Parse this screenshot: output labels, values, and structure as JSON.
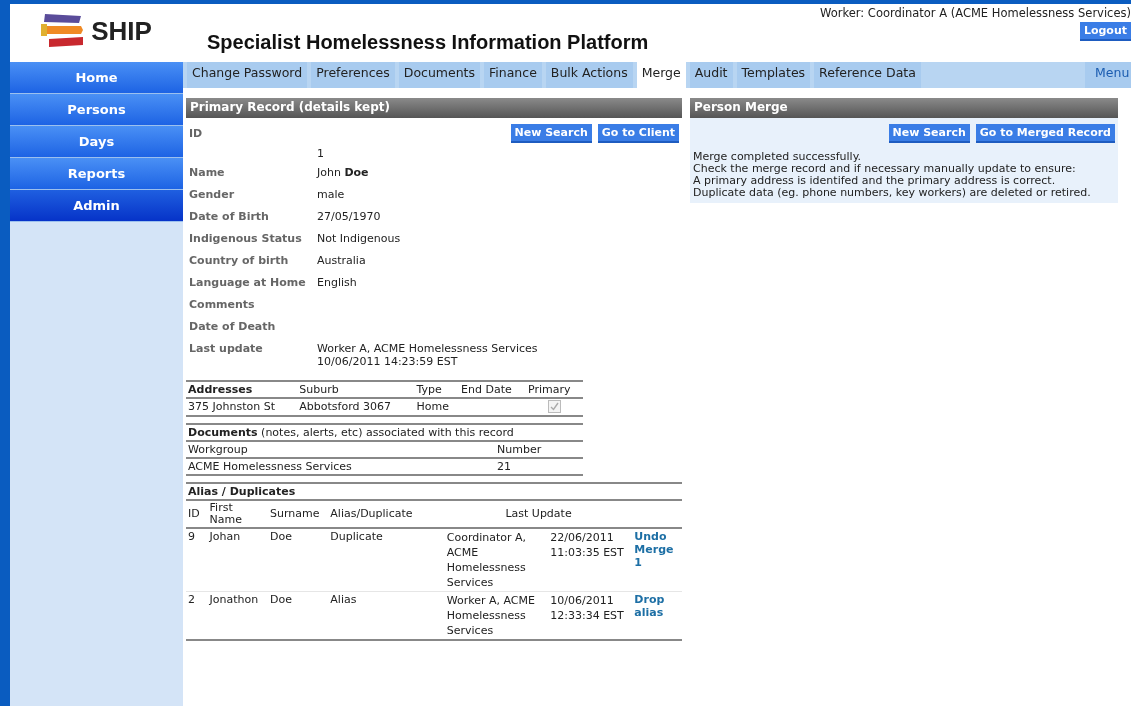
{
  "header": {
    "logo_text": "SHIP",
    "title": "Specialist Homelessness Information Platform",
    "worker": "Worker: Coordinator A (ACME Homelessness Services)",
    "logout": "Logout"
  },
  "sidebar": {
    "items": [
      {
        "label": "Home",
        "selected": false
      },
      {
        "label": "Persons",
        "selected": false
      },
      {
        "label": "Days",
        "selected": false
      },
      {
        "label": "Reports",
        "selected": false
      },
      {
        "label": "Admin",
        "selected": true
      }
    ]
  },
  "tabs": [
    {
      "label": "Change Password",
      "selected": false
    },
    {
      "label": "Preferences",
      "selected": false
    },
    {
      "label": "Documents",
      "selected": false
    },
    {
      "label": "Finance",
      "selected": false
    },
    {
      "label": "Bulk Actions",
      "selected": false
    },
    {
      "label": "Merge",
      "selected": true
    },
    {
      "label": "Audit",
      "selected": false
    },
    {
      "label": "Templates",
      "selected": false
    },
    {
      "label": "Reference Data",
      "selected": false
    }
  ],
  "menu_link": "Menu",
  "primary": {
    "title": "Primary Record (details kept)",
    "buttons": [
      "New Search",
      "Go to Client"
    ],
    "fields": [
      {
        "label": "ID",
        "kind": "stacked",
        "lines": [
          "1"
        ]
      },
      {
        "label": "Name",
        "kind": "inline",
        "lines": [
          "John **Doe**"
        ]
      },
      {
        "label": "Gender",
        "kind": "inline",
        "lines": [
          "male"
        ]
      },
      {
        "label": "Date of Birth",
        "kind": "inline",
        "lines": [
          "27/05/1970"
        ]
      },
      {
        "label": "Indigenous Status",
        "kind": "inline",
        "lines": [
          "Not Indigenous"
        ]
      },
      {
        "label": "Country of birth",
        "kind": "inline",
        "lines": [
          "Australia"
        ]
      },
      {
        "label": "Language at Home",
        "kind": "inline",
        "lines": [
          "English"
        ]
      },
      {
        "label": "Comments",
        "kind": "inline"
      },
      {
        "label": "Date of Death",
        "kind": "inline"
      },
      {
        "label": "Last update",
        "kind": "inline",
        "lines": [
          "Worker A, ACME Homelessness Services",
          "10/06/2011 14:23:59 EST"
        ]
      }
    ],
    "addresses": {
      "columns": [
        "Addresses",
        "Suburb",
        "Type",
        "End Date",
        "Primary"
      ],
      "rows": [
        {
          "address": "375 Johnston St",
          "suburb": "Abbotsford 3067",
          "type": "Home",
          "primary": true
        }
      ]
    },
    "documents": {
      "heading": "**Documents** (notes, alerts, etc) associated with this record",
      "columns": [
        "Workgroup",
        "Number"
      ],
      "rows": [
        {
          "workgroup": "ACME Homelessness Services",
          "number": "21"
        }
      ]
    },
    "aliases": {
      "title": "Alias / Duplicates",
      "columns": [
        "ID",
        "First Name",
        "Surname",
        "Alias/Duplicate",
        "Last Update"
      ],
      "rows": [
        {
          "id": "9",
          "first_name": "Johan",
          "surname": "Doe",
          "type": "Duplicate",
          "updated_by": "Coordinator A, ACME Homelessness Services",
          "updated_at": "22/06/2011 11:03:35 EST",
          "action": "Undo Merge 1"
        },
        {
          "id": "2",
          "first_name": "Jonathon",
          "surname": "Doe",
          "type": "Alias",
          "updated_by": "Worker A, ACME Homelessness Services",
          "updated_at": "10/06/2011 12:33:34 EST",
          "action": "Drop alias"
        }
      ]
    }
  },
  "merge": {
    "title": "Person Merge",
    "buttons": [
      "New Search",
      "Go to Merged Record"
    ],
    "messages": [
      "Merge completed successfully.",
      "Check the merge record and if necessary manually update to ensure:",
      "A primary address is identifed and the primary address is correct.",
      "Duplicate data (eg. phone numbers, key workers) are deleted or retired."
    ]
  }
}
